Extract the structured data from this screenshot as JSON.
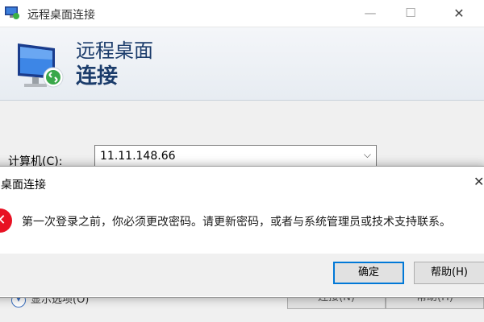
{
  "window": {
    "title": "远程桌面连接",
    "controls": {
      "minimize": "—",
      "maximize": "☐",
      "close": "✕"
    }
  },
  "banner": {
    "line1": "远程桌面",
    "line2": "连接"
  },
  "form": {
    "computer_label": "计算机(C):",
    "computer_value": "11.11.148.66",
    "options_label": "显示选项(O)",
    "connect_label": "连接(N)",
    "help_label": "帮助(H)"
  },
  "dialog": {
    "title": "桌面连接",
    "message": "第一次登录之前，你必须更改密码。请更新密码，或者与系统管理员或技术支持联系。",
    "icon": "error-icon",
    "ok_label": "确定",
    "help_label": "帮助(H)"
  },
  "colors": {
    "accent": "#0078d7",
    "banner_text": "#1b3c6b",
    "error": "#e81123"
  }
}
